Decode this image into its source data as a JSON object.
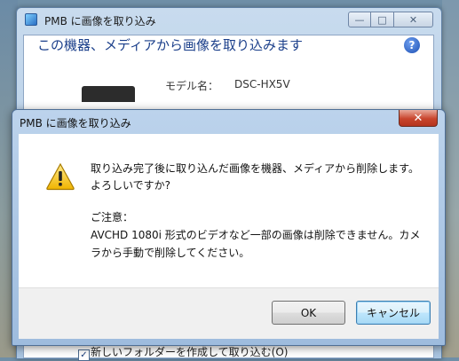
{
  "back_window": {
    "title": "PMB に画像を取り込み",
    "heading": "この機器、メディアから画像を取り込みます",
    "help_icon": "?",
    "model_label": "モデル名：",
    "model_value": "DSC-HX5V",
    "new_folder_checkbox_label": "新しいフォルダーを作成して取り込む(O)",
    "new_folder_checked": true,
    "min_symbol": "—",
    "max_symbol": "□",
    "close_symbol": "✕"
  },
  "dialog": {
    "title": "PMB に画像を取り込み",
    "close_symbol": "✕",
    "message_line1": "取り込み完了後に取り込んだ画像を機器、メディアから削除します。",
    "message_line2": "よろしいですか?",
    "note_heading": "ご注意：",
    "note_line1": "AVCHD 1080i 形式のビデオなど一部の画像は削除できません。カメ",
    "note_line2": "ラから手動で削除してください。",
    "ok_label": "OK",
    "cancel_label": "キャンセル"
  },
  "icons": {
    "dialog": "warning-icon",
    "back_help": "help-icon"
  }
}
